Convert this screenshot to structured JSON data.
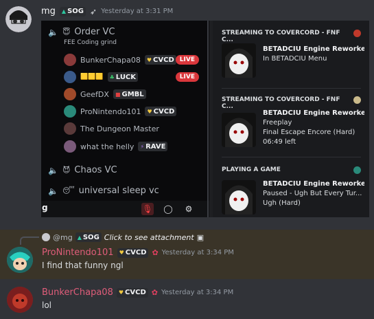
{
  "top_message": {
    "author": "mg",
    "tag": "SOG",
    "timestamp": "Yesterday at 3:31 PM"
  },
  "voice_panel": {
    "channel1": {
      "name": "Order VC",
      "status": "FEE Coding grind"
    },
    "members": [
      {
        "name": "BunkerChapa08",
        "tag": "CVCD",
        "live": "LIVE",
        "color": "#8a3a3a"
      },
      {
        "name": "",
        "tag": "LUCK",
        "emojis": "🟨🟨🟨",
        "live": "LIVE",
        "color": "#3a5a8a"
      },
      {
        "name": "GeefDX",
        "tag": "GMBL",
        "color": "#a04a2a"
      },
      {
        "name": "ProNintendo101",
        "tag": "CVCD",
        "color": "#2a8a7a"
      },
      {
        "name": "The Dungeon Master",
        "tag": "",
        "color": "#5a3a3a"
      },
      {
        "name": "what the helly",
        "tag": "RAVE",
        "color": "#7a5a7a"
      }
    ],
    "channel2": {
      "name": "Chaos VC"
    },
    "channel3": {
      "name": "universal sleep vc"
    },
    "bottom_letter": "g"
  },
  "activities": [
    {
      "header": "STREAMING TO COVERCORD - FNF C...",
      "title": "BETADCIU Engine Reworked",
      "lines": [
        "In BETADCIU Menu"
      ]
    },
    {
      "header": "STREAMING TO COVERCORD - FNF C...",
      "title": "BETADCIU Engine Reworked",
      "lines": [
        "Freeplay",
        "Final Escape Encore (Hard)",
        "06:49 left"
      ]
    },
    {
      "header": "PLAYING A GAME",
      "title": "BETADCIU Engine Reworked",
      "lines": [
        "Paused - Ugh But Every Tur...",
        "Ugh (Hard)"
      ]
    }
  ],
  "reply_ref": {
    "mention": "@mg",
    "tag": "SOG",
    "text": "Click to see attachment"
  },
  "reply_message": {
    "author": "ProNintendo101",
    "tag": "CVCD",
    "timestamp": "Yesterday at 3:34 PM",
    "text": "I find that funny ngl",
    "name_color": "#e05d7a"
  },
  "last_message": {
    "author": "BunkerChapa08",
    "tag": "CVCD",
    "timestamp": "Yesterday at 3:34 PM",
    "text": "lol",
    "name_color": "#e05d7a"
  }
}
